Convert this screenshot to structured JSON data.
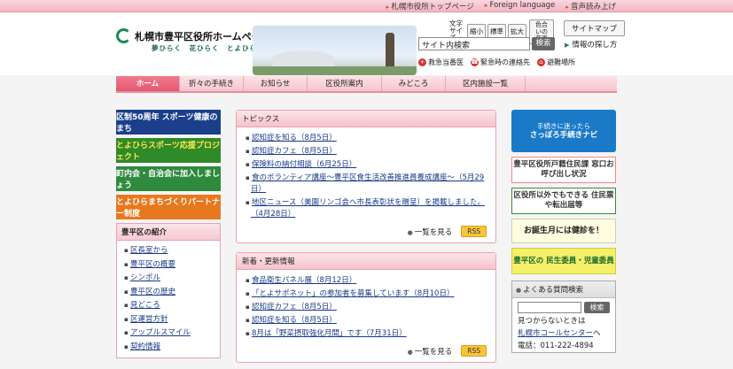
{
  "topbar": {
    "links": [
      "札幌市役所トップページ",
      "Foreign language",
      "音声読み上げ"
    ]
  },
  "header": {
    "title": "札幌市豊平区役所ホームページ",
    "tagline": "夢ひらく　花ひらく　とよひらく",
    "textsize_label": "文字サイズ",
    "textsize_buttons": [
      "縮小",
      "標準",
      "拡大"
    ],
    "color_change": "色合いの変更",
    "sitemap": "サイトマップ",
    "search_value": "サイト内検索",
    "search_button": "検索",
    "howto": "情報の探し方",
    "emergency": [
      "救急当番医",
      "緊急時の連絡先",
      "避難場所"
    ]
  },
  "nav": {
    "tabs": [
      "ホーム",
      "折々の手続き",
      "お知らせ",
      "区役所案内",
      "みどころ",
      "区内施設一覧"
    ]
  },
  "left": {
    "banners": [
      "区制50周年 スポーツ健康のまち",
      "とよひらスポーツ応援プロジェクト",
      "町内会・自治会に加入しましょう",
      "とよひらまちづくりパートナー制度"
    ],
    "intro_title": "豊平区の紹介",
    "intro_items": [
      "区長室から",
      "豊平区の概要",
      "シンボル",
      "豊平区の歴史",
      "見どころ",
      "区運営方針",
      "アップルスマイル",
      "契約情報"
    ]
  },
  "topics": {
    "title": "トピックス",
    "items": [
      "認知症を知る（8月5日）",
      "認知症カフェ（8月5日）",
      "保険料の納付相談（6月25日）",
      "食のボランティア講座～豊平区食生活改善推進員養成講座～（5月29日）",
      "地区ニュース（美園リンゴ会へ市長表彰状を贈呈）を掲載しました。（4月28日）"
    ],
    "more": "一覧を見る",
    "rss": "RSS"
  },
  "news": {
    "title": "新着・更新情報",
    "items": [
      "食品衛生パネル展（8月12日）",
      "「とよサポネット」の参加者を募集しています（8月10日）",
      "認知症カフェ（8月5日）",
      "認知症を知る（8月5日）",
      "8月は「野菜摂取強化月間」です（7月31日）"
    ],
    "more": "一覧を見る",
    "rss": "RSS"
  },
  "right": {
    "navi_small": "手続きに迷ったら",
    "navi": "さっぽろ手続きナビ",
    "mado": "豊平区役所戸籍住民課 窓口お呼び出し状況",
    "jumin": "区役所以外でもできる 住民票や転出届等",
    "kenshin": "お誕生月には健診を！",
    "minsei": "豊平区の 民生委員・児童委員",
    "faq_title": "よくある質問検索",
    "faq_button": "検索",
    "faq_text1": "見つからないときは",
    "faq_link": "札幌市コールセンター",
    "faq_text2": "へ",
    "faq_phone": "電話：011-222-4894"
  }
}
